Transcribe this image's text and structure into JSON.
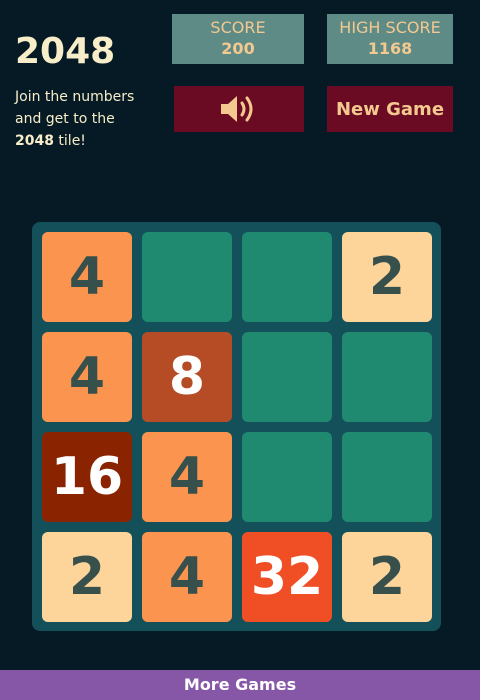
{
  "header": {
    "title": "2048",
    "intro_prefix": "Join the numbers and get to the ",
    "intro_bold": "2048",
    "intro_suffix": " tile!"
  },
  "score": {
    "label": "SCORE",
    "value": "200"
  },
  "high_score": {
    "label": "HIGH SCORE",
    "value": "1168"
  },
  "controls": {
    "sound_icon": "speaker-volume-icon",
    "new_game_label": "New Game"
  },
  "board": {
    "size": 4,
    "rows": [
      [
        "4",
        "",
        "",
        "2"
      ],
      [
        "4",
        "8",
        "",
        ""
      ],
      [
        "16",
        "4",
        "",
        ""
      ],
      [
        "2",
        "4",
        "32",
        "2"
      ]
    ]
  },
  "colors": {
    "background": "#051a24",
    "board": "#14505a",
    "empty_cell": "#1f8a6f",
    "tile_2": "#fdd49a",
    "tile_4": "#fb944e",
    "tile_8": "#b54c26",
    "tile_16": "#8a2300",
    "tile_32": "#f04e24",
    "score_box": "#5f8b87",
    "button": "#6a0b23",
    "footer": "#8656a7"
  },
  "footer": {
    "label": "More Games"
  }
}
